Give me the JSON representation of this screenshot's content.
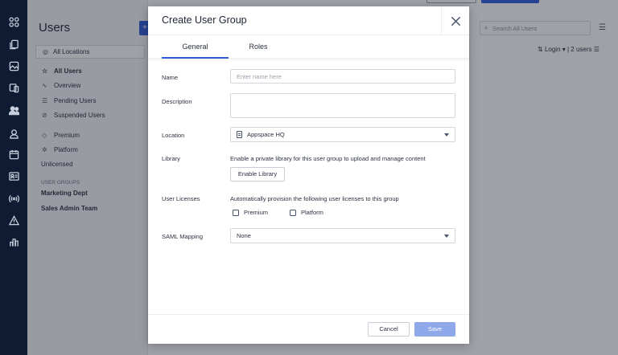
{
  "rail": {
    "icons": [
      "grid-icon",
      "copy-icon",
      "image-icon",
      "devices-icon",
      "users-icon",
      "contact-icon",
      "calendar-icon",
      "id-card-icon",
      "broadcast-icon",
      "alert-icon",
      "analytics-icon"
    ]
  },
  "background": {
    "title": "Users",
    "add_label": "+",
    "location": "All Locations",
    "nav": [
      {
        "label": "All Users",
        "icon": "users-icon"
      },
      {
        "label": "Overview",
        "icon": "activity-icon"
      },
      {
        "label": "Pending Users",
        "icon": "pending-icon"
      },
      {
        "label": "Suspended Users",
        "icon": "block-icon"
      },
      {
        "label": "Premium",
        "icon": "diamond-icon"
      },
      {
        "label": "Platform",
        "icon": "platform-icon"
      }
    ],
    "unlicensed": "Unlicensed",
    "groups_header": "USER GROUPS",
    "groups": [
      "Marketing Dept",
      "Sales Admin Team"
    ],
    "search_placeholder": "Search All Users",
    "sort_label": "Login ▾",
    "count_label": "2 users"
  },
  "modal": {
    "title": "Create User Group",
    "tabs": [
      "General",
      "Roles"
    ],
    "active_tab": "General",
    "fields": {
      "name_label": "Name",
      "name_placeholder": "Enter name here",
      "description_label": "Description",
      "location_label": "Location",
      "location_value": "Appspace HQ",
      "library_label": "Library",
      "library_helper": "Enable a private library for this user group to upload and manage content",
      "library_button": "Enable Library",
      "licenses_label": "User Licenses",
      "licenses_helper": "Automatically provision the following user licenses to this group",
      "license_options": [
        "Premium",
        "Platform"
      ],
      "saml_label": "SAML Mapping",
      "saml_value": "None"
    },
    "footer": {
      "cancel_label": "Cancel",
      "save_label": "Save"
    }
  },
  "colors": {
    "rail_bg": "#0e1b33",
    "accent": "#2f5bd6",
    "save_disabled": "#8ea8ea"
  }
}
